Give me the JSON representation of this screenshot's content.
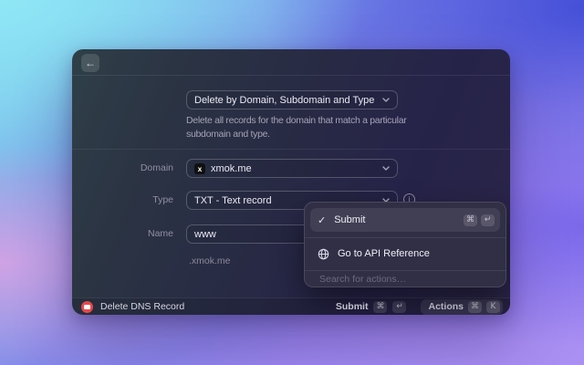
{
  "form": {
    "mode": {
      "value": "Delete by Domain, Subdomain and Type",
      "description": "Delete all records for the domain that match a particular subdomain and type."
    },
    "domain": {
      "label": "Domain",
      "favicon_letter": "x",
      "value": "xmok.me"
    },
    "type": {
      "label": "Type",
      "value": "TXT - Text record"
    },
    "name": {
      "label": "Name",
      "value": "www",
      "hint": ".xmok.me"
    }
  },
  "actions_popover": {
    "items": [
      {
        "label": "Submit",
        "selected": true,
        "keys": [
          "⌘",
          "↵"
        ]
      },
      {
        "label": "Go to API Reference"
      }
    ],
    "search_placeholder": "Search for actions…"
  },
  "status_bar": {
    "title": "Delete DNS Record",
    "primary_action": {
      "label": "Submit",
      "keys": [
        "⌘",
        "↵"
      ]
    },
    "actions_button": {
      "label": "Actions",
      "keys": [
        "⌘",
        "K"
      ]
    }
  },
  "colors": {
    "accent_red": "#e5484d",
    "window_bg": "#282b44",
    "popover_bg": "#312f45"
  }
}
